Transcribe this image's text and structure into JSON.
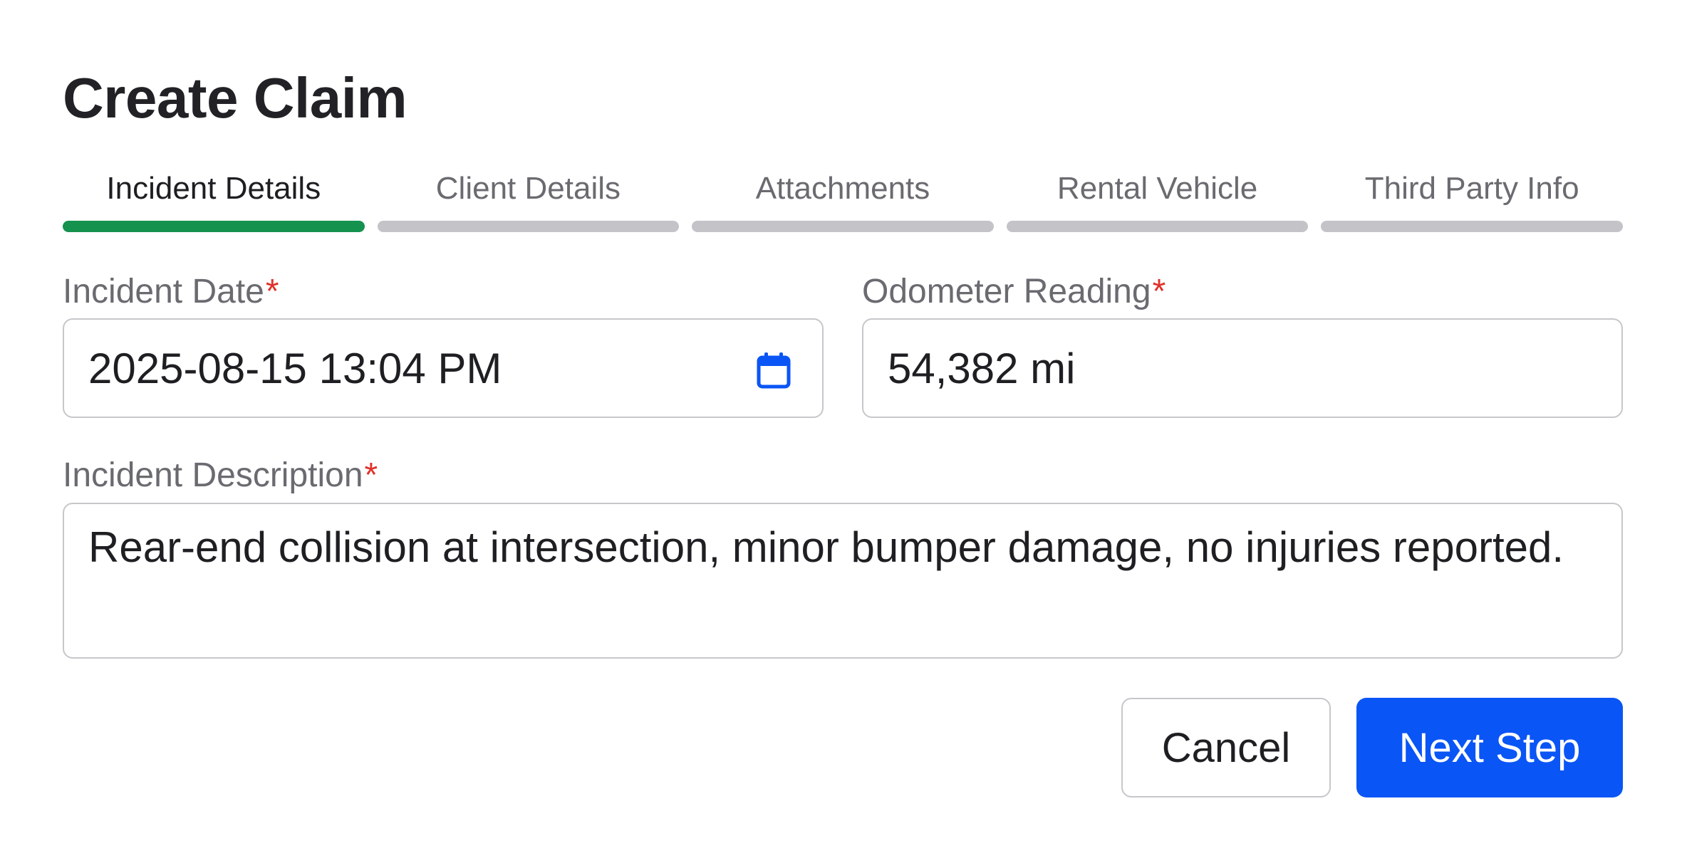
{
  "dialog": {
    "title": "Create Claim"
  },
  "steps": [
    {
      "label": "Incident Details",
      "active": true
    },
    {
      "label": "Client Details",
      "active": false
    },
    {
      "label": "Attachments",
      "active": false
    },
    {
      "label": "Rental Vehicle",
      "active": false
    },
    {
      "label": "Third Party Info",
      "active": false
    }
  ],
  "colors": {
    "active_step": "#14924e",
    "inactive_step": "#c4c4c8",
    "required": "#e0312a",
    "primary_button": "#0a55f5"
  },
  "form": {
    "incident_date": {
      "label": "Incident Date",
      "required_mark": "*",
      "value": "2025-08-15 13:04 PM",
      "icon": "calendar-icon"
    },
    "odometer": {
      "label": "Odometer Reading",
      "required_mark": "*",
      "value": "54,382 mi"
    },
    "description": {
      "label": "Incident Description",
      "required_mark": "*",
      "value": "Rear-end collision at intersection, minor bumper damage, no injuries reported."
    }
  },
  "actions": {
    "cancel_label": "Cancel",
    "next_label": "Next Step"
  }
}
